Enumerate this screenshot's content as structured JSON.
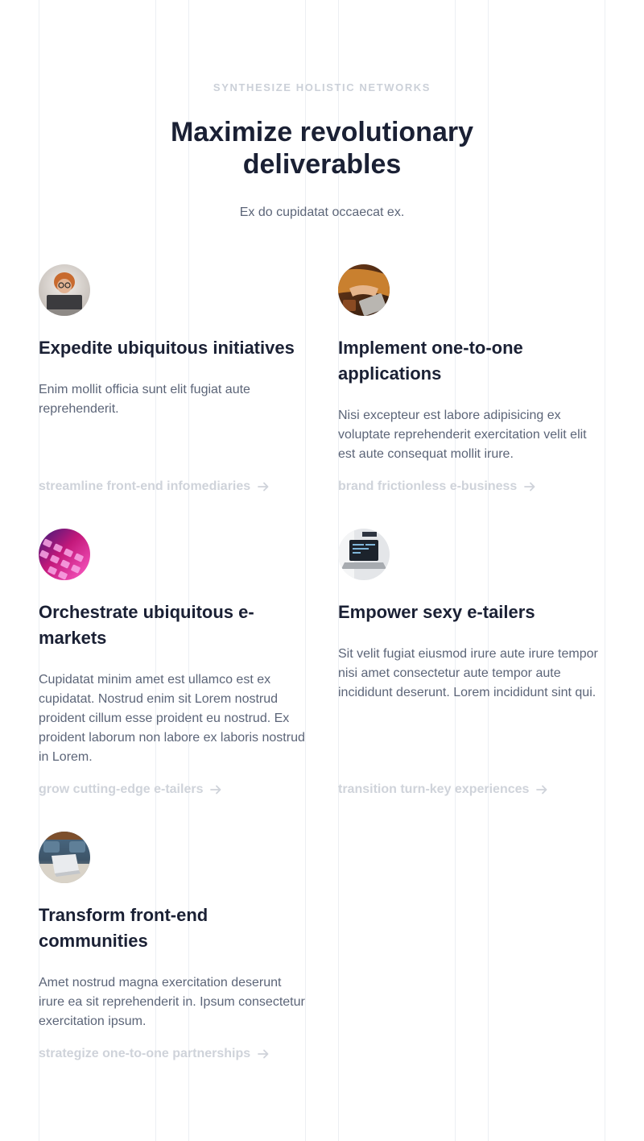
{
  "section": {
    "eyebrow": "SYNTHESIZE HOLISTIC NETWORKS",
    "title": "Maximize revolutionary deliverables",
    "subtitle": "Ex do cupidatat occaecat ex."
  },
  "features": [
    {
      "image": "person-with-laptop-image",
      "title": "Expedite ubiquitous initiatives",
      "description": "Enim mollit officia sunt elit fugiat aute reprehenderit.",
      "link": "streamline front-end infomediaries"
    },
    {
      "image": "hands-typing-laptop-image",
      "title": "Implement one-to-one applications",
      "description": "Nisi excepteur est labore adipisicing ex voluptate reprehenderit exercitation velit elit est aute consequat mollit irure.",
      "link": "brand frictionless e-business"
    },
    {
      "image": "colorful-keyboard-image",
      "title": "Orchestrate ubiquitous e-markets",
      "description": "Cupidatat minim amet est ullamco est ex cupidatat. Nostrud enim sit Lorem nostrud proident cillum esse proident eu nostrud. Ex proident laborum non labore ex laboris nostrud in Lorem.",
      "link": "grow cutting-edge e-tailers"
    },
    {
      "image": "laptop-workspace-image",
      "title": "Empower sexy e-tailers",
      "description": "Sit velit fugiat eiusmod irure aute irure tempor nisi amet consectetur aute tempor aute incididunt deserunt. Lorem incididunt sint qui.",
      "link": "transition turn-key experiences"
    },
    {
      "image": "laptop-on-desk-image",
      "title": "Transform front-end communities",
      "description": "Amet nostrud magna exercitation deserunt irure ea sit reprehenderit in. Ipsum consectetur exercitation ipsum.",
      "link": "strategize one-to-one partnerships"
    }
  ],
  "icons": {
    "link_arrow": "arrow-right-icon"
  },
  "colors": {
    "heading": "#1a2034",
    "body_text": "#5c6578",
    "muted_link": "#cfd3da",
    "eyebrow": "#cbd0d8",
    "grid_line": "#eceff3"
  }
}
